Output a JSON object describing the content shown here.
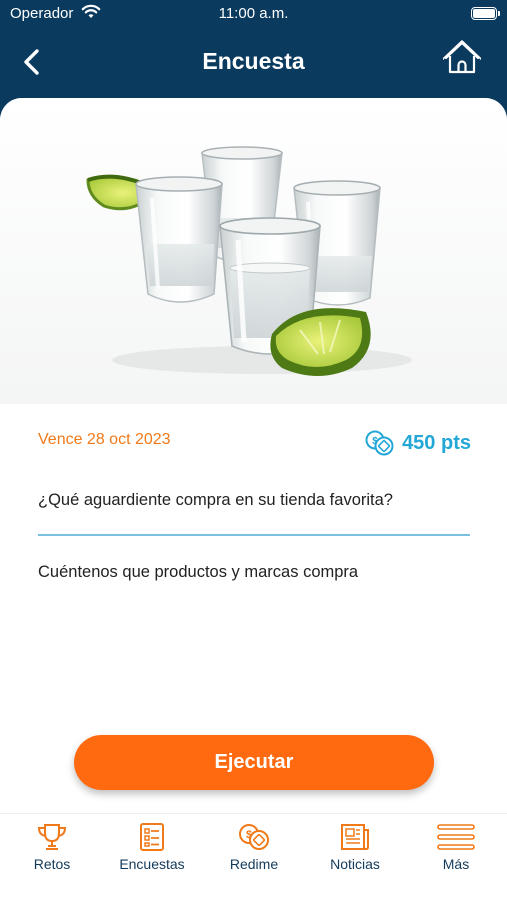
{
  "status_bar": {
    "carrier": "Operador",
    "time": "11:00 a.m."
  },
  "header": {
    "title": "Encuesta",
    "back_icon": "chevron-left-icon",
    "home_icon": "home-icon"
  },
  "survey": {
    "expires": "Vence 28 oct 2023",
    "points": "450 pts",
    "question": "¿Qué aguardiente compra en su tienda favorita?",
    "description": "Cuéntenos que productos y marcas compra"
  },
  "actions": {
    "execute_label": "Ejecutar"
  },
  "tabbar": {
    "items": [
      {
        "label": "Retos",
        "icon": "trophy-icon"
      },
      {
        "label": "Encuestas",
        "icon": "survey-list-icon"
      },
      {
        "label": "Redime",
        "icon": "coins-icon"
      },
      {
        "label": "Noticias",
        "icon": "newspaper-icon"
      },
      {
        "label": "Más",
        "icon": "menu-icon"
      }
    ]
  },
  "colors": {
    "header_bg": "#0a3a5e",
    "accent_orange": "#ff6a10",
    "points_blue": "#22a7d6",
    "expires_orange": "#f07a1a",
    "divider_blue": "#7bbfe3",
    "tab_icon_orange": "#f07a1a",
    "tab_label_navy": "#123a5a"
  }
}
